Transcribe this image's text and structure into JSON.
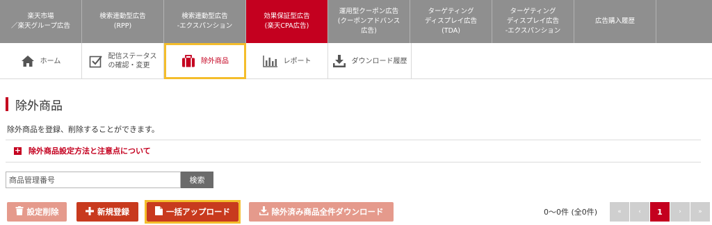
{
  "top_nav": [
    {
      "label": "楽天市場\n／楽天グループ広告"
    },
    {
      "label": "検索連動型広告\n(RPP)"
    },
    {
      "label": "検索連動型広告\n-エクスパンション"
    },
    {
      "label": "効果保証型広告\n(楽天CPA広告)",
      "active": true
    },
    {
      "label": "運用型クーポン広告\n(クーポンアドバンス\n広告)"
    },
    {
      "label": "ターゲティング\nディスプレイ広告\n(TDA)"
    },
    {
      "label": "ターゲティング\nディスプレイ広告\n-エクスパンション"
    },
    {
      "label": "広告購入履歴"
    }
  ],
  "sub_nav": [
    {
      "label": "ホーム",
      "icon": "home-icon"
    },
    {
      "label": "配信ステータス\nの確認・変更",
      "icon": "checkbox-icon"
    },
    {
      "label": "除外商品",
      "icon": "suitcase-icon",
      "active": true
    },
    {
      "label": "レポート",
      "icon": "bar-chart-icon"
    },
    {
      "label": "ダウンロード履歴",
      "icon": "download-icon"
    }
  ],
  "page": {
    "title": "除外商品",
    "description": "除外商品を登録、削除することができます。",
    "notes_link": "除外商品設定方法と注意点について"
  },
  "search": {
    "placeholder": "商品管理番号",
    "button": "検索"
  },
  "actions": {
    "delete": "設定削除",
    "new": "新規登録",
    "bulk_upload": "一括アップロード",
    "download_all": "除外済み商品全件ダウンロード"
  },
  "pagination": {
    "count": "0〜0件 (全0件)",
    "first": "«",
    "prev": "‹",
    "current": "1",
    "next": "›",
    "last": "»"
  },
  "colors": {
    "brand_red": "#c4001f",
    "highlight": "#f4bd2b",
    "nav_gray": "#8f8f8f"
  }
}
